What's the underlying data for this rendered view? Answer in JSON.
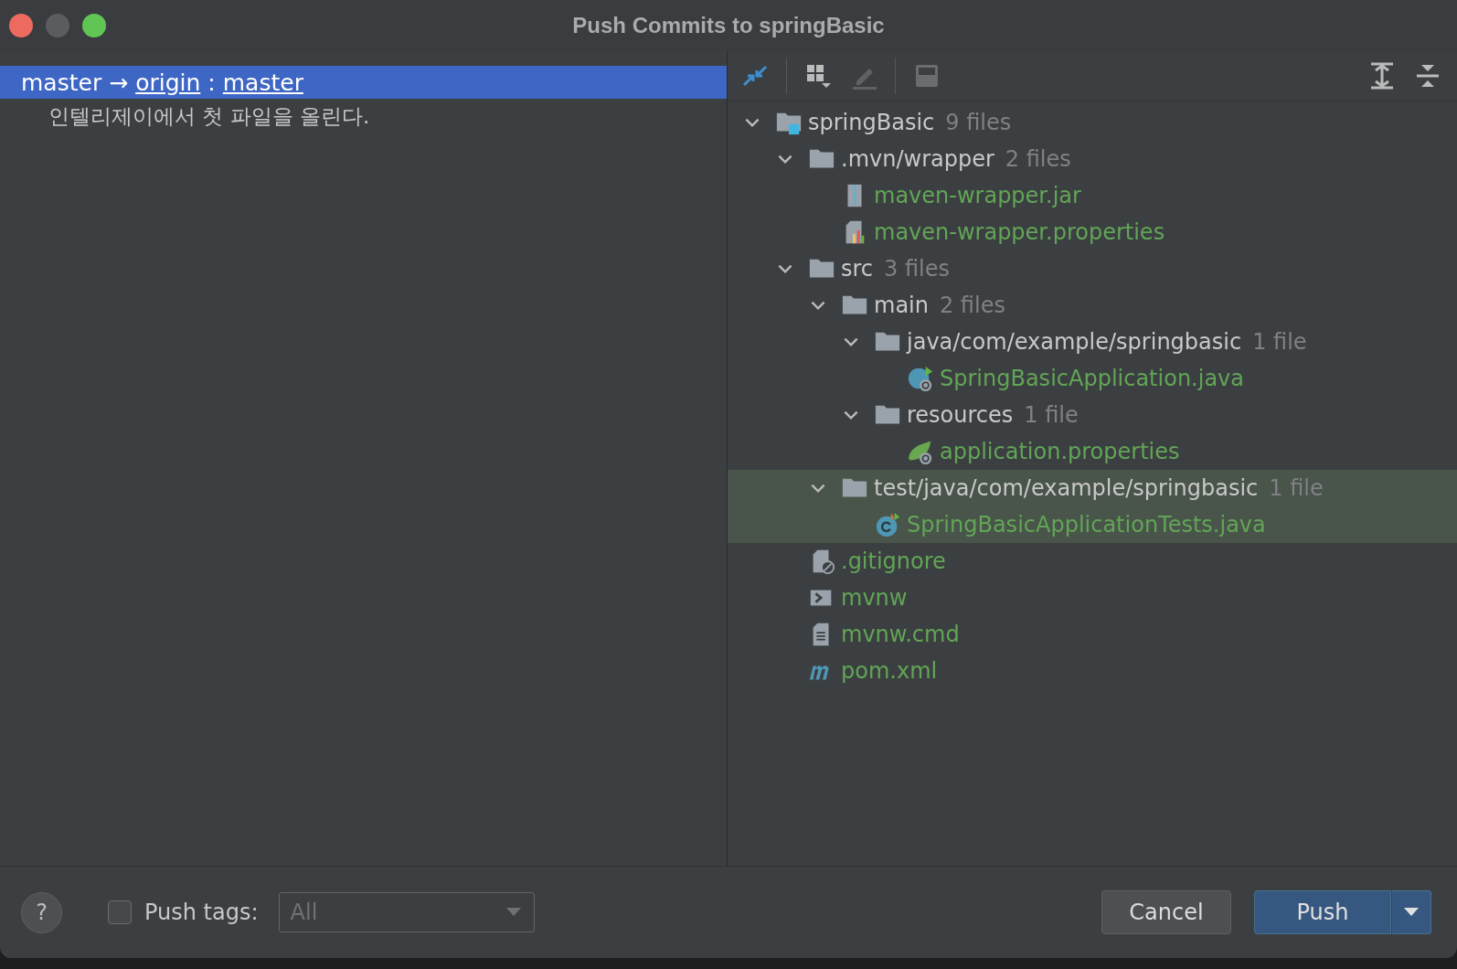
{
  "window": {
    "title": "Push Commits to springBasic"
  },
  "commits": {
    "branch": {
      "selected": true,
      "local": "master",
      "arrow": "→",
      "remote": "origin",
      "separator": ":",
      "remote_branch": "master"
    },
    "messages": [
      "인텔리제이에서 첫 파일을 올린다."
    ]
  },
  "tree": {
    "items": [
      {
        "kind": "project",
        "name": "springBasic",
        "count": "9 files",
        "expanded": true,
        "selected": false,
        "children": [
          {
            "kind": "folder",
            "name": ".mvn/wrapper",
            "count": "2 files",
            "expanded": true,
            "selected": false,
            "children": [
              {
                "kind": "jar",
                "name": "maven-wrapper.jar",
                "selected": false
              },
              {
                "kind": "properties",
                "name": "maven-wrapper.properties",
                "selected": false
              }
            ]
          },
          {
            "kind": "folder",
            "name": "src",
            "count": "3 files",
            "expanded": true,
            "selected": false,
            "children": [
              {
                "kind": "folder",
                "name": "main",
                "count": "2 files",
                "expanded": true,
                "selected": false,
                "children": [
                  {
                    "kind": "folder",
                    "name": "java/com/example/springbasic",
                    "count": "1 file",
                    "expanded": true,
                    "selected": false,
                    "children": [
                      {
                        "kind": "spring-class",
                        "name": "SpringBasicApplication.java",
                        "selected": false
                      }
                    ]
                  },
                  {
                    "kind": "folder",
                    "name": "resources",
                    "count": "1 file",
                    "expanded": true,
                    "selected": false,
                    "children": [
                      {
                        "kind": "spring-props",
                        "name": "application.properties",
                        "selected": false
                      }
                    ]
                  }
                ]
              },
              {
                "kind": "folder",
                "name": "test/java/com/example/springbasic",
                "count": "1 file",
                "expanded": true,
                "selected": true,
                "children": [
                  {
                    "kind": "test-class",
                    "name": "SpringBasicApplicationTests.java",
                    "selected": true
                  }
                ]
              }
            ]
          },
          {
            "kind": "gitignore",
            "name": ".gitignore",
            "selected": false
          },
          {
            "kind": "script",
            "name": "mvnw",
            "selected": false
          },
          {
            "kind": "cmd",
            "name": "mvnw.cmd",
            "selected": false
          },
          {
            "kind": "maven",
            "name": "pom.xml",
            "selected": false
          }
        ]
      }
    ]
  },
  "footer": {
    "help": "?",
    "push_tags": {
      "checked": false,
      "label": "Push tags:"
    },
    "tags_dropdown": {
      "value": "All",
      "disabled": true
    },
    "buttons": [
      {
        "label": "Cancel",
        "kind": "secondary"
      },
      {
        "label": "Push",
        "kind": "primary"
      }
    ]
  }
}
